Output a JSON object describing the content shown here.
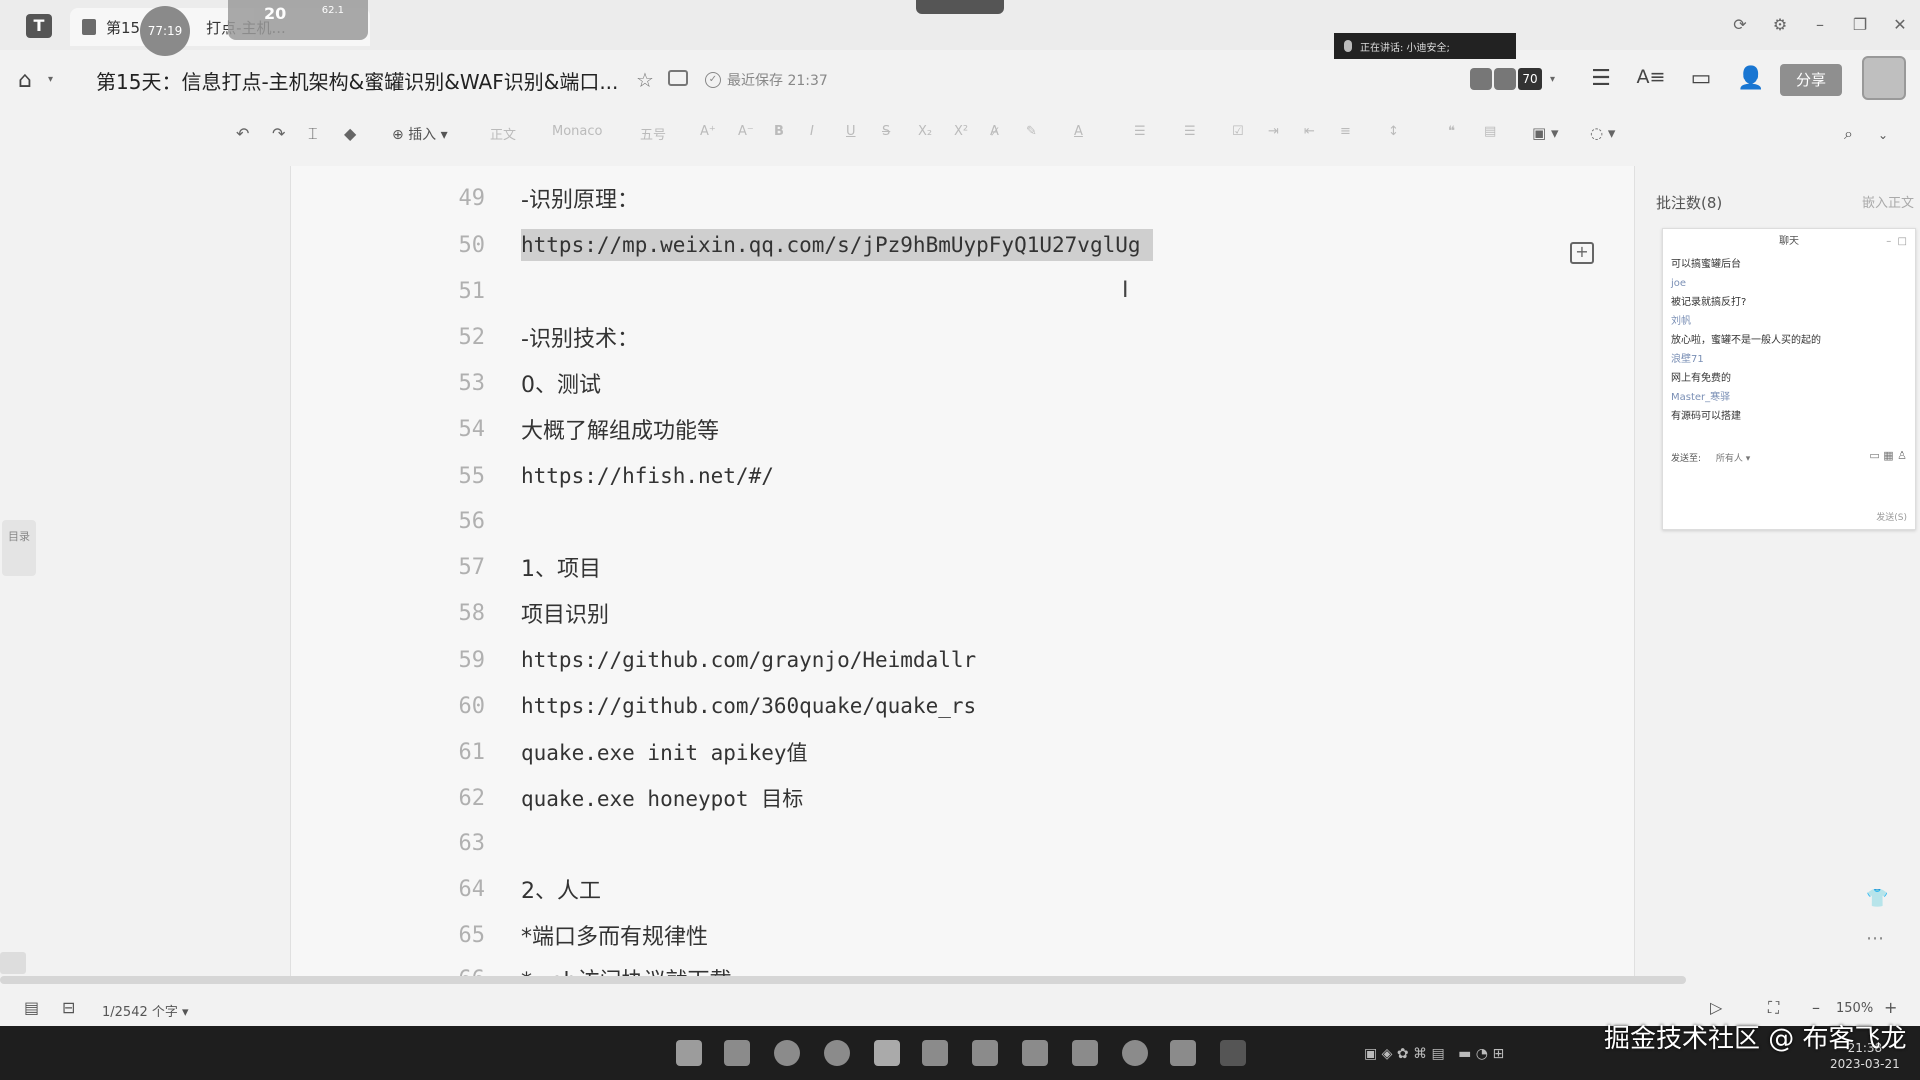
{
  "tabbar": {
    "tab_prefix": "第15",
    "tab_suffix": "打点-主机...",
    "timer": "77:19",
    "meeting_count": "20",
    "meeting_sub": "62.1"
  },
  "window": {
    "minimize": "–",
    "restore": "❐",
    "close": "✕",
    "refresh": "⟳",
    "settings": "⚙"
  },
  "header": {
    "title": "第15天：信息打点-主机架构&蜜罐识别&WAF识别&端口...",
    "save_status": "最近保存 21:37",
    "live_banner": "正在讲话: 小迪安全;",
    "collaborator_count": "70",
    "share_label": "分享"
  },
  "toolbar": {
    "insert_label": "插入",
    "style_label": "正文",
    "font_label": "Monaco",
    "size_label": "五号"
  },
  "editor": {
    "lines": [
      {
        "num": "49",
        "text": "-识别原理："
      },
      {
        "num": "50",
        "text": "https://mp.weixin.qq.com/s/jPz9hBmUypFyQ1U27vglUg"
      },
      {
        "num": "51",
        "text": ""
      },
      {
        "num": "52",
        "text": "-识别技术："
      },
      {
        "num": "53",
        "text": "0、测试"
      },
      {
        "num": "54",
        "text": "大概了解组成功能等"
      },
      {
        "num": "55",
        "text": "https://hfish.net/#/"
      },
      {
        "num": "56",
        "text": ""
      },
      {
        "num": "57",
        "text": "1、项目"
      },
      {
        "num": "58",
        "text": "项目识别"
      },
      {
        "num": "59",
        "text": "https://github.com/graynjo/Heimdallr"
      },
      {
        "num": "60",
        "text": "https://github.com/360quake/quake_rs"
      },
      {
        "num": "61",
        "text": "quake.exe init apikey值"
      },
      {
        "num": "62",
        "text": "quake.exe honeypot 目标"
      },
      {
        "num": "63",
        "text": ""
      },
      {
        "num": "64",
        "text": "2、人工"
      },
      {
        "num": "65",
        "text": "*端口多而有规律性"
      },
      {
        "num": "66",
        "text": "*web访问协议就下载"
      }
    ]
  },
  "sidebar": {
    "outline_label": "目录"
  },
  "comments": {
    "title": "批注数(8)",
    "embed_label": "嵌入正文",
    "chat_title": "聊天",
    "messages": [
      {
        "text": "可以搞蜜罐后台",
        "is_name": false
      },
      {
        "text": "joe",
        "is_name": true
      },
      {
        "text": "被记录就搞反打?",
        "is_name": false
      },
      {
        "text": "刘帆",
        "is_name": true
      },
      {
        "text": "放心啦，蜜罐不是一般人买的起的",
        "is_name": false
      },
      {
        "text": "浪壁71",
        "is_name": true
      },
      {
        "text": "网上有免费的",
        "is_name": false
      },
      {
        "text": "Master_寒驿",
        "is_name": true
      },
      {
        "text": "有源码可以搭建",
        "is_name": false
      }
    ],
    "send_to_label": "发送至:",
    "send_to_value": "所有人",
    "send_button": "发送(S)"
  },
  "status": {
    "word_count": "1/2542 个字",
    "zoom": "150%"
  },
  "taskbar": {
    "time": "21:38",
    "date": "2023-03-21",
    "watermark": "掘金技术社区 @ 布客飞龙"
  }
}
